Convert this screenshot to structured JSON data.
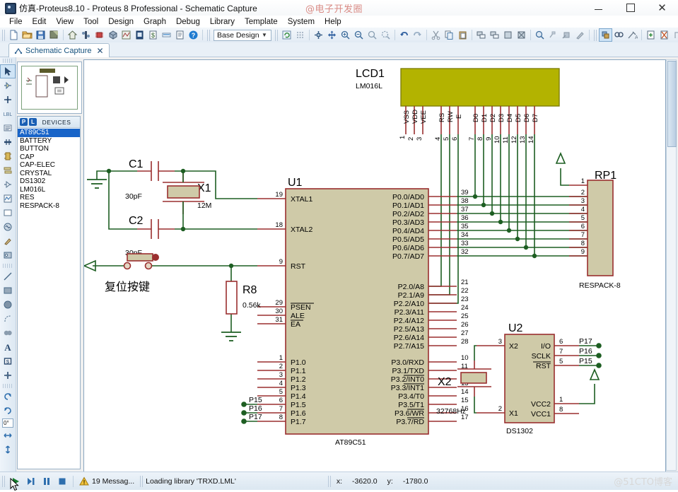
{
  "window": {
    "title": "仿真-Proteus8.10 - Proteus 8 Professional - Schematic Capture",
    "app_icon": "proteus-icon",
    "watermark_top": "@电子开发圈",
    "minimize": "–",
    "maximize": "□",
    "close": "✕"
  },
  "menubar": {
    "items": [
      {
        "label": "File",
        "name": "menu-file"
      },
      {
        "label": "Edit",
        "name": "menu-edit"
      },
      {
        "label": "View",
        "name": "menu-view"
      },
      {
        "label": "Tool",
        "name": "menu-tool"
      },
      {
        "label": "Design",
        "name": "menu-design"
      },
      {
        "label": "Graph",
        "name": "menu-graph"
      },
      {
        "label": "Debug",
        "name": "menu-debug"
      },
      {
        "label": "Library",
        "name": "menu-library"
      },
      {
        "label": "Template",
        "name": "menu-template"
      },
      {
        "label": "System",
        "name": "menu-system"
      },
      {
        "label": "Help",
        "name": "menu-help"
      }
    ]
  },
  "toolbar": {
    "sheet_selector_value": "Base Design",
    "sheet_selector_caret": "⌄"
  },
  "doctab": {
    "label": "Schematic Capture",
    "close": "✕"
  },
  "left_toolbar": {
    "rotation_value": "0°"
  },
  "devices_panel": {
    "badge_p": "P",
    "badge_l": "L",
    "title": "DEVICES",
    "items": [
      {
        "label": "AT89C51",
        "selected": true
      },
      {
        "label": "BATTERY",
        "selected": false
      },
      {
        "label": "BUTTON",
        "selected": false
      },
      {
        "label": "CAP",
        "selected": false
      },
      {
        "label": "CAP-ELEC",
        "selected": false
      },
      {
        "label": "CRYSTAL",
        "selected": false
      },
      {
        "label": "DS1302",
        "selected": false
      },
      {
        "label": "LM016L",
        "selected": false
      },
      {
        "label": "RES",
        "selected": false
      },
      {
        "label": "RESPACK-8",
        "selected": false
      }
    ]
  },
  "statusbar": {
    "messages": "19 Messag...",
    "loading": "Loading library 'TRXD.LML'",
    "coord_x_label": "x:",
    "coord_x": "-3620.0",
    "coord_y_label": "y:",
    "coord_y": "-1780.0",
    "watermark": "@51CTO博客"
  },
  "schematic": {
    "colors": {
      "body_fill": "#cfcaa8",
      "body_stroke": "#9a2f2f",
      "pin_wire": "#9a2f2f",
      "net_wire": "#1d5e22",
      "lcd_screen": "#b3b300",
      "text": "#000000",
      "chinese_label": "#2222cc"
    },
    "lcd": {
      "ref": "LCD1",
      "part": "LM016L",
      "pins": [
        {
          "num": "1",
          "name": "VSS"
        },
        {
          "num": "2",
          "name": "VDD"
        },
        {
          "num": "3",
          "name": "VEE"
        },
        {
          "num": "4",
          "name": "RS"
        },
        {
          "num": "5",
          "name": "RW"
        },
        {
          "num": "6",
          "name": "E"
        },
        {
          "num": "7",
          "name": "D0"
        },
        {
          "num": "8",
          "name": "D1"
        },
        {
          "num": "9",
          "name": "D2"
        },
        {
          "num": "10",
          "name": "D3"
        },
        {
          "num": "11",
          "name": "D4"
        },
        {
          "num": "12",
          "name": "D5"
        },
        {
          "num": "13",
          "name": "D6"
        },
        {
          "num": "14",
          "name": "D7"
        }
      ]
    },
    "mcu": {
      "ref": "U1",
      "part": "AT89C51",
      "left_pins_top": [
        {
          "num": "19",
          "name": "XTAL1"
        },
        {
          "num": "18",
          "name": "XTAL2"
        },
        {
          "num": "9",
          "name": "RST"
        }
      ],
      "left_pins_ctrl": [
        {
          "num": "29",
          "name": "PSEN",
          "overline": true
        },
        {
          "num": "30",
          "name": "ALE",
          "overline": false
        },
        {
          "num": "31",
          "name": "EA",
          "overline": true
        }
      ],
      "left_pins_p1": [
        {
          "num": "1",
          "name": "P1.0"
        },
        {
          "num": "2",
          "name": "P1.1"
        },
        {
          "num": "3",
          "name": "P1.2"
        },
        {
          "num": "4",
          "name": "P1.3"
        },
        {
          "num": "5",
          "name": "P1.4"
        },
        {
          "num": "6",
          "name": "P1.5"
        },
        {
          "num": "7",
          "name": "P1.6"
        },
        {
          "num": "8",
          "name": "P1.7"
        }
      ],
      "right_pins_p0": [
        {
          "num": "39",
          "name": "P0.0/AD0"
        },
        {
          "num": "38",
          "name": "P0.1/AD1"
        },
        {
          "num": "37",
          "name": "P0.2/AD2"
        },
        {
          "num": "36",
          "name": "P0.3/AD3"
        },
        {
          "num": "35",
          "name": "P0.4/AD4"
        },
        {
          "num": "34",
          "name": "P0.5/AD5"
        },
        {
          "num": "33",
          "name": "P0.6/AD6"
        },
        {
          "num": "32",
          "name": "P0.7/AD7"
        }
      ],
      "right_pins_p2": [
        {
          "num": "21",
          "name": "P2.0/A8"
        },
        {
          "num": "22",
          "name": "P2.1/A9"
        },
        {
          "num": "23",
          "name": "P2.2/A10"
        },
        {
          "num": "24",
          "name": "P2.3/A11"
        },
        {
          "num": "25",
          "name": "P2.4/A12"
        },
        {
          "num": "26",
          "name": "P2.5/A13"
        },
        {
          "num": "27",
          "name": "P2.6/A14"
        },
        {
          "num": "28",
          "name": "P2.7/A15"
        }
      ],
      "right_pins_p3": [
        {
          "num": "10",
          "name": "P3.0/RXD"
        },
        {
          "num": "11",
          "name": "P3.1/TXD"
        },
        {
          "num": "12",
          "name": "P3.2/INT0",
          "overline_part": "INT0"
        },
        {
          "num": "13",
          "name": "P3.3/INT1",
          "overline_part": "INT1"
        },
        {
          "num": "14",
          "name": "P3.4/T0"
        },
        {
          "num": "15",
          "name": "P3.5/T1"
        },
        {
          "num": "16",
          "name": "P3.6/WR",
          "overline_part": "WR"
        },
        {
          "num": "17",
          "name": "P3.7/RD",
          "overline_part": "RD"
        }
      ],
      "net_labels_p1": [
        {
          "label": "P15",
          "pin": "6"
        },
        {
          "label": "P16",
          "pin": "7"
        },
        {
          "label": "P17",
          "pin": "8"
        }
      ]
    },
    "crystal_circuit": {
      "c1_ref": "C1",
      "c1_value": "30pF",
      "c2_ref": "C2",
      "c2_value": "30pF",
      "x1_ref": "X1",
      "x1_value": "12M"
    },
    "reset_circuit": {
      "button_label": "复位按键",
      "r8_ref": "R8",
      "r8_value": "0.56k"
    },
    "respack": {
      "ref": "RP1",
      "part": "RESPACK-8",
      "pins": [
        "1",
        "2",
        "3",
        "4",
        "5",
        "6",
        "7",
        "8",
        "9"
      ]
    },
    "rtc": {
      "ref": "U2",
      "part": "DS1302",
      "x2_ref": "X2",
      "x2_value": "32768Hz",
      "left_pins": [
        {
          "num": "3",
          "name": "X2"
        },
        {
          "num": "2",
          "name": "X1"
        }
      ],
      "right_pins": [
        {
          "num": "6",
          "name": "I/O",
          "net": "P17"
        },
        {
          "num": "7",
          "name": "SCLK",
          "net": "P16"
        },
        {
          "num": "5",
          "name": "RST",
          "net": "P15",
          "overline": true
        },
        {
          "num": "1",
          "name": "VCC2",
          "net": ""
        },
        {
          "num": "8",
          "name": "VCC1",
          "net": ""
        }
      ]
    }
  }
}
